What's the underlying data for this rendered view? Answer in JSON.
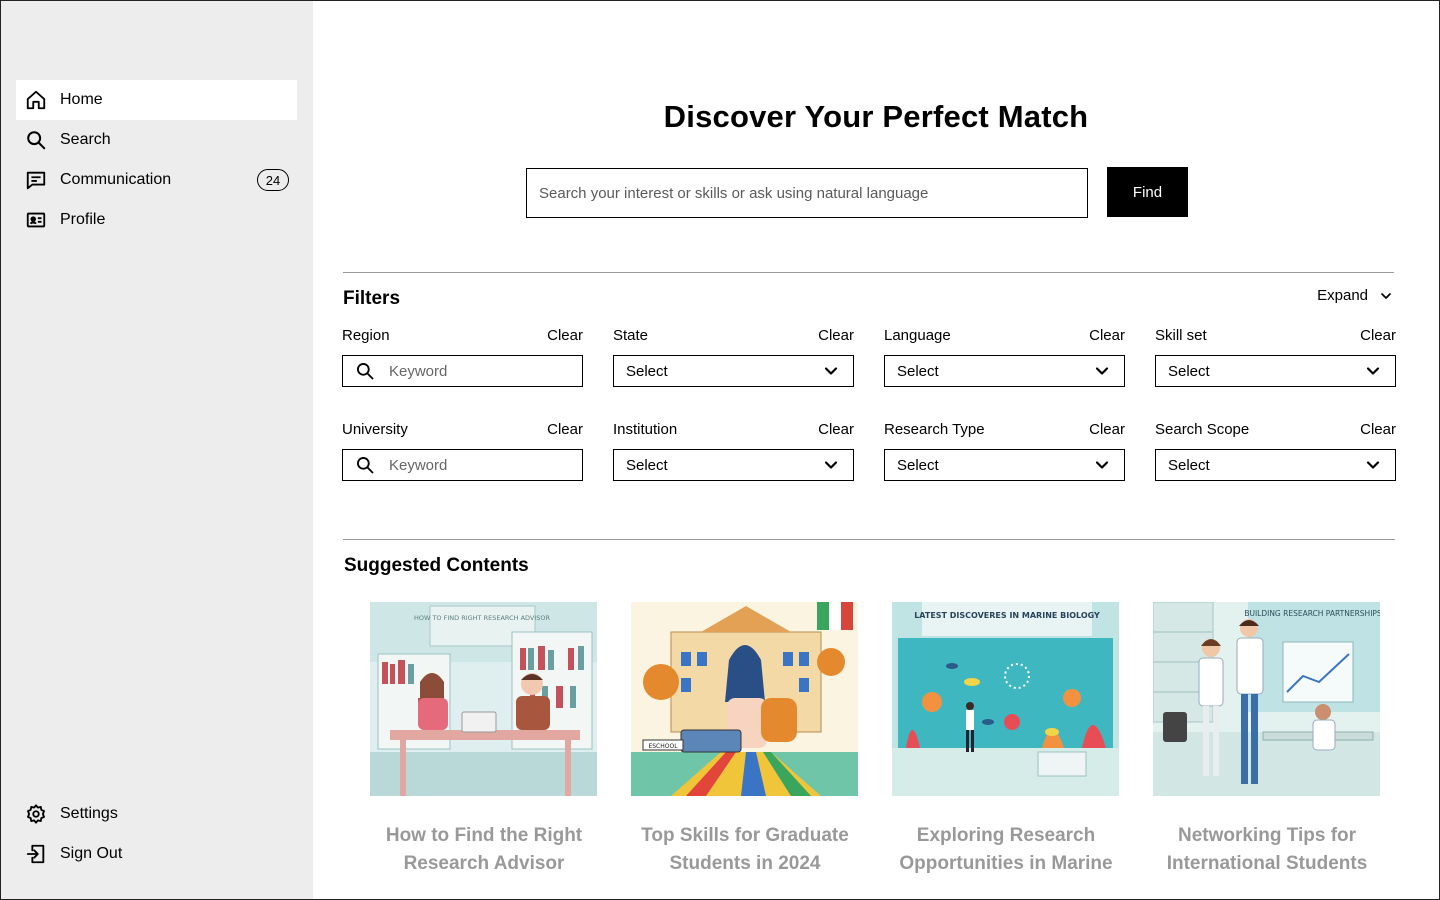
{
  "sidebar": {
    "items": [
      {
        "label": "Home",
        "icon": "home-icon",
        "active": true
      },
      {
        "label": "Search",
        "icon": "search-icon"
      },
      {
        "label": "Communication",
        "icon": "chat-icon",
        "badge": "24"
      },
      {
        "label": "Profile",
        "icon": "id-card-icon"
      }
    ],
    "bottom": [
      {
        "label": "Settings",
        "icon": "gear-icon"
      },
      {
        "label": "Sign Out",
        "icon": "sign-out-icon"
      }
    ]
  },
  "hero": {
    "title": "Discover Your Perfect Match",
    "search_placeholder": "Search your interest or skills or ask using natural language",
    "find_label": "Find"
  },
  "filters": {
    "title": "Filters",
    "expand_label": "Expand",
    "clear_label": "Clear",
    "items": [
      {
        "label": "Region",
        "type": "keyword",
        "placeholder": "Keyword"
      },
      {
        "label": "State",
        "type": "select",
        "value": "Select"
      },
      {
        "label": "Language",
        "type": "select",
        "value": "Select"
      },
      {
        "label": "Skill set",
        "type": "select",
        "value": "Select"
      },
      {
        "label": "University",
        "type": "keyword",
        "placeholder": "Keyword"
      },
      {
        "label": "Institution",
        "type": "select",
        "value": "Select"
      },
      {
        "label": "Research Type",
        "type": "select",
        "value": "Select"
      },
      {
        "label": "Search Scope",
        "type": "select",
        "value": "Select"
      }
    ]
  },
  "suggested": {
    "title": "Suggested Contents",
    "cards": [
      {
        "title": "How to Find the Right Research Advisor",
        "image_text": "HOW TO FIND RIGHT RESEARCH ADVISOR"
      },
      {
        "title": "Top Skills for Graduate Students in 2024",
        "image_text": "ESCHOOL"
      },
      {
        "title": "Exploring Research Opportunities in Marine",
        "image_text": "LATEST DISCOVERES IN MARINE BIOLOGY"
      },
      {
        "title": "Networking Tips for International Students",
        "image_text": "BUILDING RESEARCH PARTNERSHIPS"
      }
    ]
  },
  "colors": {
    "sidebar_bg": "#ededed",
    "accent": "#000000",
    "muted_title": "#999999"
  }
}
